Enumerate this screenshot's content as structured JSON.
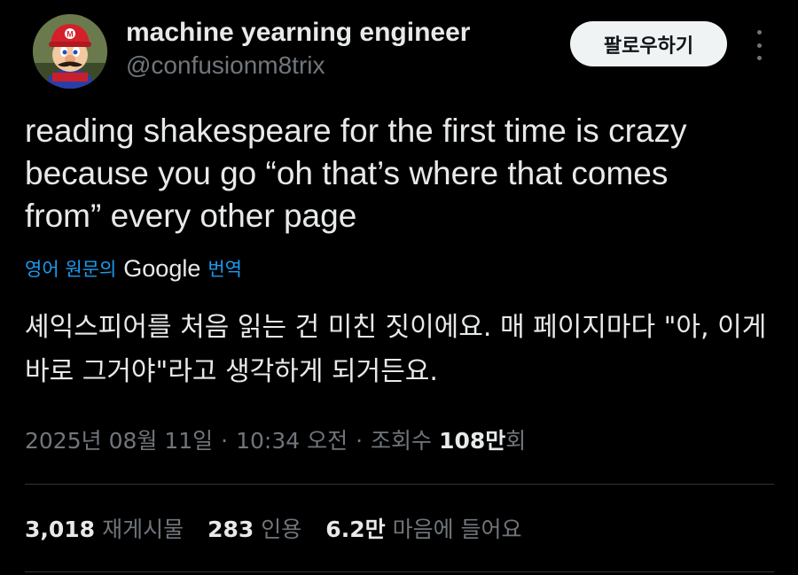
{
  "author": {
    "display_name": "machine yearning engineer",
    "handle": "@confusionm8trix",
    "avatar_icon": "mario-avatar"
  },
  "actions": {
    "follow_label": "팔로우하기",
    "more_icon": "more-options-icon"
  },
  "tweet": {
    "text": "reading shakespeare for the first time is crazy because you go “oh that’s where that comes from” every other page",
    "translate_prefix": "영어 원문의",
    "translate_brand": "Google",
    "translate_suffix": "번역",
    "translated_text": "셰익스피어를 처음 읽는 건 미친 짓이에요. 매 페이지마다 \"아, 이게 바로 그거야\"라고 생각하게 되거든요."
  },
  "meta": {
    "date": "2025년 08월 11일",
    "time": "10:34 오전",
    "views_prefix": "조회수",
    "views_count": "108만",
    "views_suffix": "회",
    "separator": "·"
  },
  "stats": {
    "retweets_count": "3,018",
    "retweets_label": "재게시물",
    "quotes_count": "283",
    "quotes_label": "인용",
    "likes_count": "6.2만",
    "likes_label": "마음에 들어요"
  },
  "colors": {
    "background": "#000000",
    "primary_text": "#e7e9ea",
    "secondary_text": "#71767b",
    "link": "#1d9bf0",
    "divider": "#2f3336",
    "follow_button_bg": "#eff3f4"
  }
}
